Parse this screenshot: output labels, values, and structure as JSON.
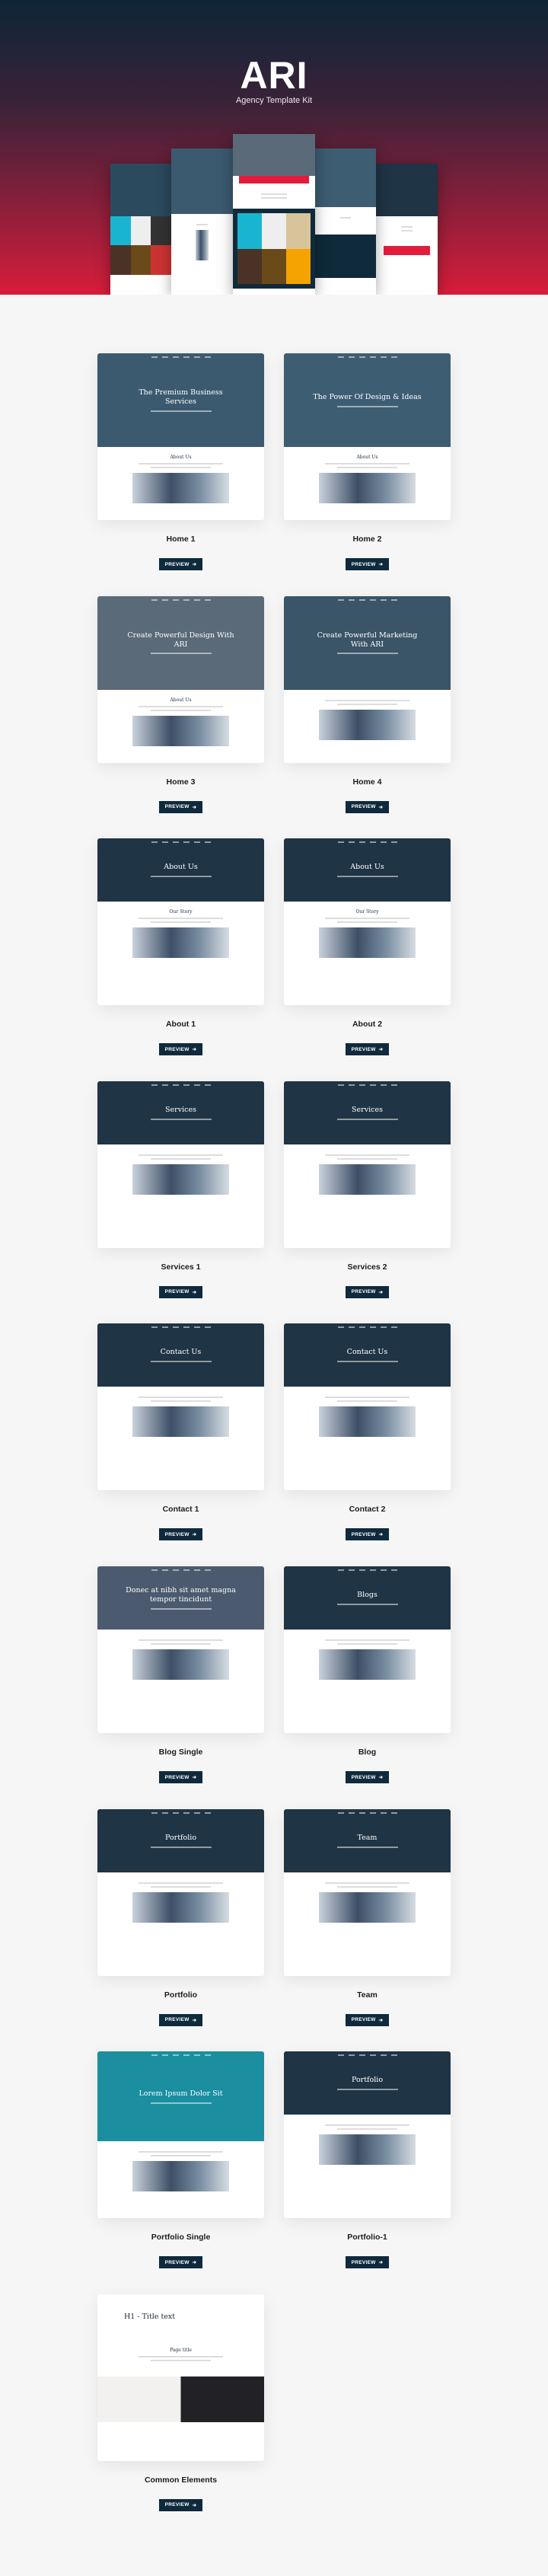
{
  "header": {
    "brand": "ARI",
    "tagline": "Agency Template Kit",
    "gradient_top": "#0e2537",
    "gradient_bottom": "#d81d3a"
  },
  "accent": "#e31c3d",
  "button_color": "#0f2a3d",
  "preview_label": "PREVIEW",
  "preview_icon": "arrow-right-icon",
  "templates": [
    {
      "label": "Home 1",
      "headline": "The Premium Business Services",
      "hero_color": "#3b5a70",
      "section": "About Us"
    },
    {
      "label": "Home 2",
      "headline": "The Power Of Design & Ideas",
      "hero_color": "#3d5d72",
      "section": "About Us"
    },
    {
      "label": "Home 3",
      "headline": "Create Powerful Design With ARI",
      "hero_color": "#5a6a78",
      "section": "About Us"
    },
    {
      "label": "Home 4",
      "headline": "Create Powerful Marketing With ARI",
      "hero_color": "#3a5468",
      "section": ""
    },
    {
      "label": "About 1",
      "headline": "About Us",
      "hero_color": "#1f3445",
      "section": "Our Story"
    },
    {
      "label": "About 2",
      "headline": "About Us",
      "hero_color": "#1f3445",
      "section": "Our Story"
    },
    {
      "label": "Services 1",
      "headline": "Services",
      "hero_color": "#1f3445",
      "section": ""
    },
    {
      "label": "Services 2",
      "headline": "Services",
      "hero_color": "#1f3445",
      "section": ""
    },
    {
      "label": "Contact 1",
      "headline": "Contact Us",
      "hero_color": "#1f3445",
      "section": ""
    },
    {
      "label": "Contact 2",
      "headline": "Contact Us",
      "hero_color": "#1f3445",
      "section": ""
    },
    {
      "label": "Blog Single",
      "headline": "Donec at nibh sit amet magna tempor tincidunt",
      "hero_color": "#4b5a6e",
      "section": ""
    },
    {
      "label": "Blog",
      "headline": "Blogs",
      "hero_color": "#1f3445",
      "section": ""
    },
    {
      "label": "Portfolio",
      "headline": "Portfolio",
      "hero_color": "#1f3445",
      "section": ""
    },
    {
      "label": "Team",
      "headline": "Team",
      "hero_color": "#1f3445",
      "section": ""
    },
    {
      "label": "Portfolio Single",
      "headline": "Lorem Ipsum Dolor Sit",
      "hero_color": "#1b8ea0",
      "section": ""
    },
    {
      "label": "Portfolio-1",
      "headline": "Portfolio",
      "hero_color": "#1f3445",
      "section": ""
    },
    {
      "label": "Common Elements",
      "headline": "H1 - Title text",
      "hero_color": "#ffffff",
      "section": "Page title"
    }
  ]
}
